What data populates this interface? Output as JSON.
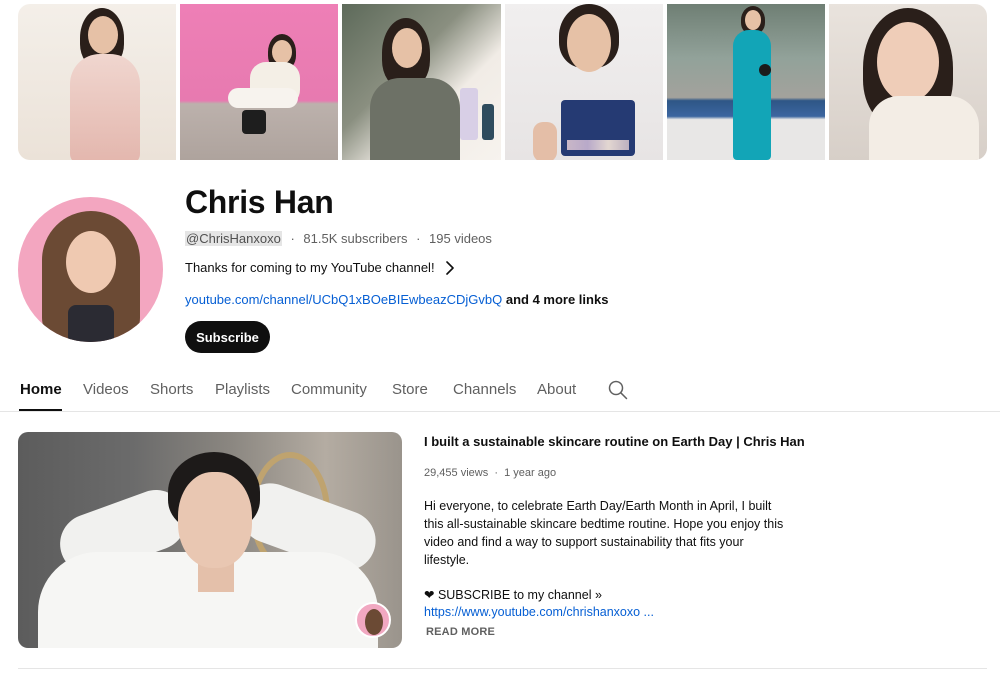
{
  "channel": {
    "name": "Chris Han",
    "handle": "@ChrisHanxoxo",
    "subscribers": "81.5K subscribers",
    "videos_count": "195 videos",
    "meta_separator": "·",
    "description": "Thanks for coming to my YouTube channel!",
    "link": "youtube.com/channel/UCbQ1xBOeBIEwbeazCDjGvbQ",
    "more_links": "and 4 more links",
    "subscribe_label": "Subscribe"
  },
  "tabs": [
    {
      "label": "Home",
      "active": true
    },
    {
      "label": "Videos"
    },
    {
      "label": "Shorts"
    },
    {
      "label": "Playlists"
    },
    {
      "label": "Community"
    },
    {
      "label": "Store"
    },
    {
      "label": "Channels"
    },
    {
      "label": "About"
    }
  ],
  "featured": {
    "title": "I built a sustainable skincare routine on Earth Day | Chris Han",
    "views": "29,455 views",
    "age": "1 year ago",
    "meta_separator": "·",
    "description": "Hi everyone, to celebrate Earth Day/Earth Month in April, I built this all-sustainable skincare bedtime routine. Hope you enjoy this video and find a way to support sustainability that fits your lifestyle.",
    "subscribe_line": "❤ SUBSCRIBE to my channel »",
    "link": "https://www.youtube.com/chrishanxoxo ...",
    "read_more": "READ MORE"
  },
  "icons": {
    "search": "search-icon",
    "chevron": "chevron-right-icon"
  },
  "colors": {
    "link": "#065fd4",
    "subscribe_bg": "#0f0f0f",
    "secondary_text": "#606060"
  }
}
